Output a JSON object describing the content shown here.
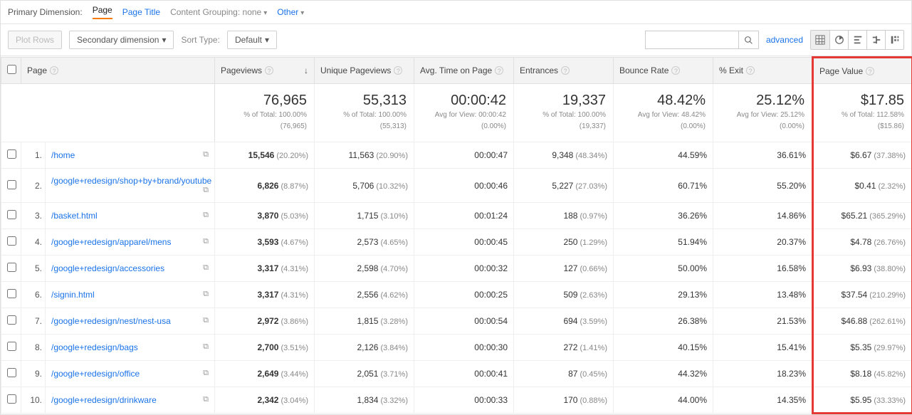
{
  "topbar": {
    "primary_dimension_label": "Primary Dimension:",
    "tabs": {
      "page": "Page",
      "page_title": "Page Title",
      "content_grouping": "Content Grouping:",
      "content_grouping_value": "none",
      "other": "Other"
    }
  },
  "toolbar": {
    "plot_rows": "Plot Rows",
    "secondary_dimension": "Secondary dimension",
    "sort_type_label": "Sort Type:",
    "sort_type_value": "Default",
    "advanced": "advanced",
    "view_icons": {
      "table": "table-icon",
      "percentage": "percentage-icon",
      "performance": "performance-icon",
      "comparison": "comparison-icon",
      "pivot": "pivot-icon"
    }
  },
  "columns": {
    "page": "Page",
    "pageviews": "Pageviews",
    "unique_pageviews": "Unique Pageviews",
    "avg_time": "Avg. Time on Page",
    "entrances": "Entrances",
    "bounce_rate": "Bounce Rate",
    "exit": "% Exit",
    "page_value": "Page Value"
  },
  "summary": {
    "pageviews": {
      "value": "76,965",
      "sub1": "% of Total: 100.00%",
      "sub2": "(76,965)"
    },
    "unique_pageviews": {
      "value": "55,313",
      "sub1": "% of Total: 100.00%",
      "sub2": "(55,313)"
    },
    "avg_time": {
      "value": "00:00:42",
      "sub1": "Avg for View: 00:00:42",
      "sub2": "(0.00%)"
    },
    "entrances": {
      "value": "19,337",
      "sub1": "% of Total: 100.00%",
      "sub2": "(19,337)"
    },
    "bounce_rate": {
      "value": "48.42%",
      "sub1": "Avg for View: 48.42%",
      "sub2": "(0.00%)"
    },
    "exit": {
      "value": "25.12%",
      "sub1": "Avg for View: 25.12%",
      "sub2": "(0.00%)"
    },
    "page_value": {
      "value": "$17.85",
      "sub1": "% of Total: 112.58%",
      "sub2": "($15.86)"
    }
  },
  "rows": [
    {
      "idx": "1.",
      "page": "/home",
      "pv": "15,546",
      "pv_pct": "(20.20%)",
      "upv": "11,563",
      "upv_pct": "(20.90%)",
      "t": "00:00:47",
      "ent": "9,348",
      "ent_pct": "(48.34%)",
      "br": "44.59%",
      "ex": "36.61%",
      "val": "$6.67",
      "val_pct": "(37.38%)"
    },
    {
      "idx": "2.",
      "page": "/google+redesign/shop+by+brand/youtube",
      "pv": "6,826",
      "pv_pct": "(8.87%)",
      "upv": "5,706",
      "upv_pct": "(10.32%)",
      "t": "00:00:46",
      "ent": "5,227",
      "ent_pct": "(27.03%)",
      "br": "60.71%",
      "ex": "55.20%",
      "val": "$0.41",
      "val_pct": "(2.32%)"
    },
    {
      "idx": "3.",
      "page": "/basket.html",
      "pv": "3,870",
      "pv_pct": "(5.03%)",
      "upv": "1,715",
      "upv_pct": "(3.10%)",
      "t": "00:01:24",
      "ent": "188",
      "ent_pct": "(0.97%)",
      "br": "36.26%",
      "ex": "14.86%",
      "val": "$65.21",
      "val_pct": "(365.29%)"
    },
    {
      "idx": "4.",
      "page": "/google+redesign/apparel/mens",
      "pv": "3,593",
      "pv_pct": "(4.67%)",
      "upv": "2,573",
      "upv_pct": "(4.65%)",
      "t": "00:00:45",
      "ent": "250",
      "ent_pct": "(1.29%)",
      "br": "51.94%",
      "ex": "20.37%",
      "val": "$4.78",
      "val_pct": "(26.76%)"
    },
    {
      "idx": "5.",
      "page": "/google+redesign/accessories",
      "pv": "3,317",
      "pv_pct": "(4.31%)",
      "upv": "2,598",
      "upv_pct": "(4.70%)",
      "t": "00:00:32",
      "ent": "127",
      "ent_pct": "(0.66%)",
      "br": "50.00%",
      "ex": "16.58%",
      "val": "$6.93",
      "val_pct": "(38.80%)"
    },
    {
      "idx": "6.",
      "page": "/signin.html",
      "pv": "3,317",
      "pv_pct": "(4.31%)",
      "upv": "2,556",
      "upv_pct": "(4.62%)",
      "t": "00:00:25",
      "ent": "509",
      "ent_pct": "(2.63%)",
      "br": "29.13%",
      "ex": "13.48%",
      "val": "$37.54",
      "val_pct": "(210.29%)"
    },
    {
      "idx": "7.",
      "page": "/google+redesign/nest/nest-usa",
      "pv": "2,972",
      "pv_pct": "(3.86%)",
      "upv": "1,815",
      "upv_pct": "(3.28%)",
      "t": "00:00:54",
      "ent": "694",
      "ent_pct": "(3.59%)",
      "br": "26.38%",
      "ex": "21.53%",
      "val": "$46.88",
      "val_pct": "(262.61%)"
    },
    {
      "idx": "8.",
      "page": "/google+redesign/bags",
      "pv": "2,700",
      "pv_pct": "(3.51%)",
      "upv": "2,126",
      "upv_pct": "(3.84%)",
      "t": "00:00:30",
      "ent": "272",
      "ent_pct": "(1.41%)",
      "br": "40.15%",
      "ex": "15.41%",
      "val": "$5.35",
      "val_pct": "(29.97%)"
    },
    {
      "idx": "9.",
      "page": "/google+redesign/office",
      "pv": "2,649",
      "pv_pct": "(3.44%)",
      "upv": "2,051",
      "upv_pct": "(3.71%)",
      "t": "00:00:41",
      "ent": "87",
      "ent_pct": "(0.45%)",
      "br": "44.32%",
      "ex": "18.23%",
      "val": "$8.18",
      "val_pct": "(45.82%)"
    },
    {
      "idx": "10.",
      "page": "/google+redesign/drinkware",
      "pv": "2,342",
      "pv_pct": "(3.04%)",
      "upv": "1,834",
      "upv_pct": "(3.32%)",
      "t": "00:00:33",
      "ent": "170",
      "ent_pct": "(0.88%)",
      "br": "44.00%",
      "ex": "14.35%",
      "val": "$5.95",
      "val_pct": "(33.33%)"
    }
  ]
}
